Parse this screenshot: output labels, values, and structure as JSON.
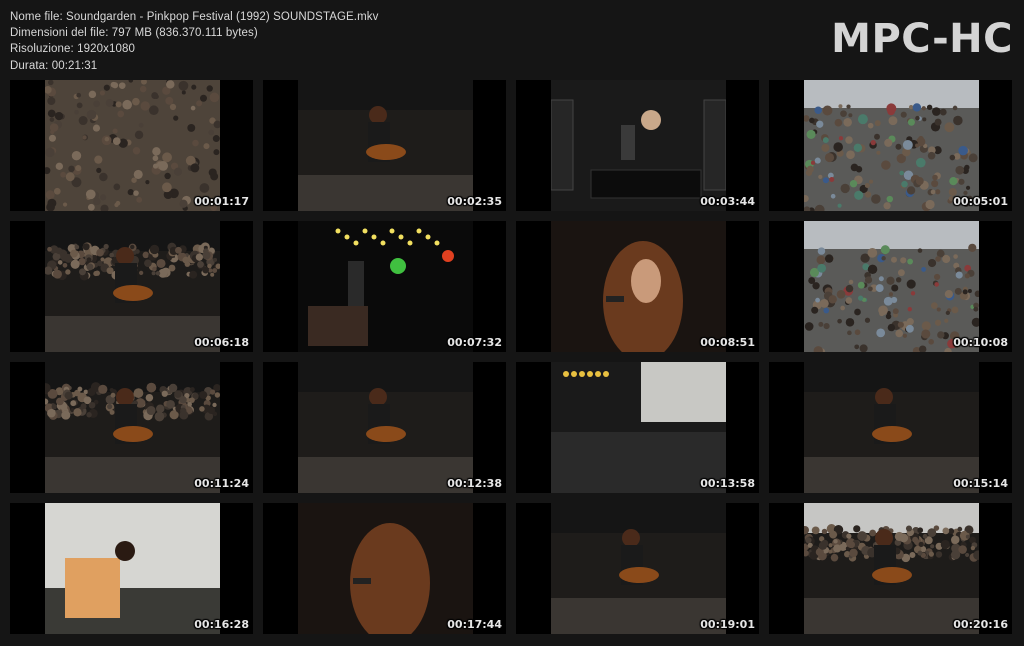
{
  "file_info": {
    "name": "Nome file: Soundgarden - Pinkpop Festival (1992) SOUNDSTAGE.mkv",
    "size": "Dimensioni del file: 797 MB (836.370.111 bytes)",
    "resolution": "Risoluzione: 1920x1080",
    "duration": "Durata: 00:21:31"
  },
  "logo": "MPC-HC",
  "thumbnails": [
    {
      "timestamp": "00:01:17",
      "scene": "crowd"
    },
    {
      "timestamp": "00:02:35",
      "scene": "guitarist-drums"
    },
    {
      "timestamp": "00:03:44",
      "scene": "stage-wide"
    },
    {
      "timestamp": "00:05:01",
      "scene": "crowd-umbrellas"
    },
    {
      "timestamp": "00:06:18",
      "scene": "stage-side"
    },
    {
      "timestamp": "00:07:32",
      "scene": "stage-lights"
    },
    {
      "timestamp": "00:08:51",
      "scene": "singer-closeup"
    },
    {
      "timestamp": "00:10:08",
      "scene": "crowd-umbrellas"
    },
    {
      "timestamp": "00:11:24",
      "scene": "stage-side"
    },
    {
      "timestamp": "00:12:38",
      "scene": "guitarist-amps"
    },
    {
      "timestamp": "00:13:58",
      "scene": "stage-night"
    },
    {
      "timestamp": "00:15:14",
      "scene": "singer-amps"
    },
    {
      "timestamp": "00:16:28",
      "scene": "guitarist-sky"
    },
    {
      "timestamp": "00:17:44",
      "scene": "singer-back"
    },
    {
      "timestamp": "00:19:01",
      "scene": "guitarist-drums"
    },
    {
      "timestamp": "00:20:16",
      "scene": "stage-crowd"
    }
  ]
}
